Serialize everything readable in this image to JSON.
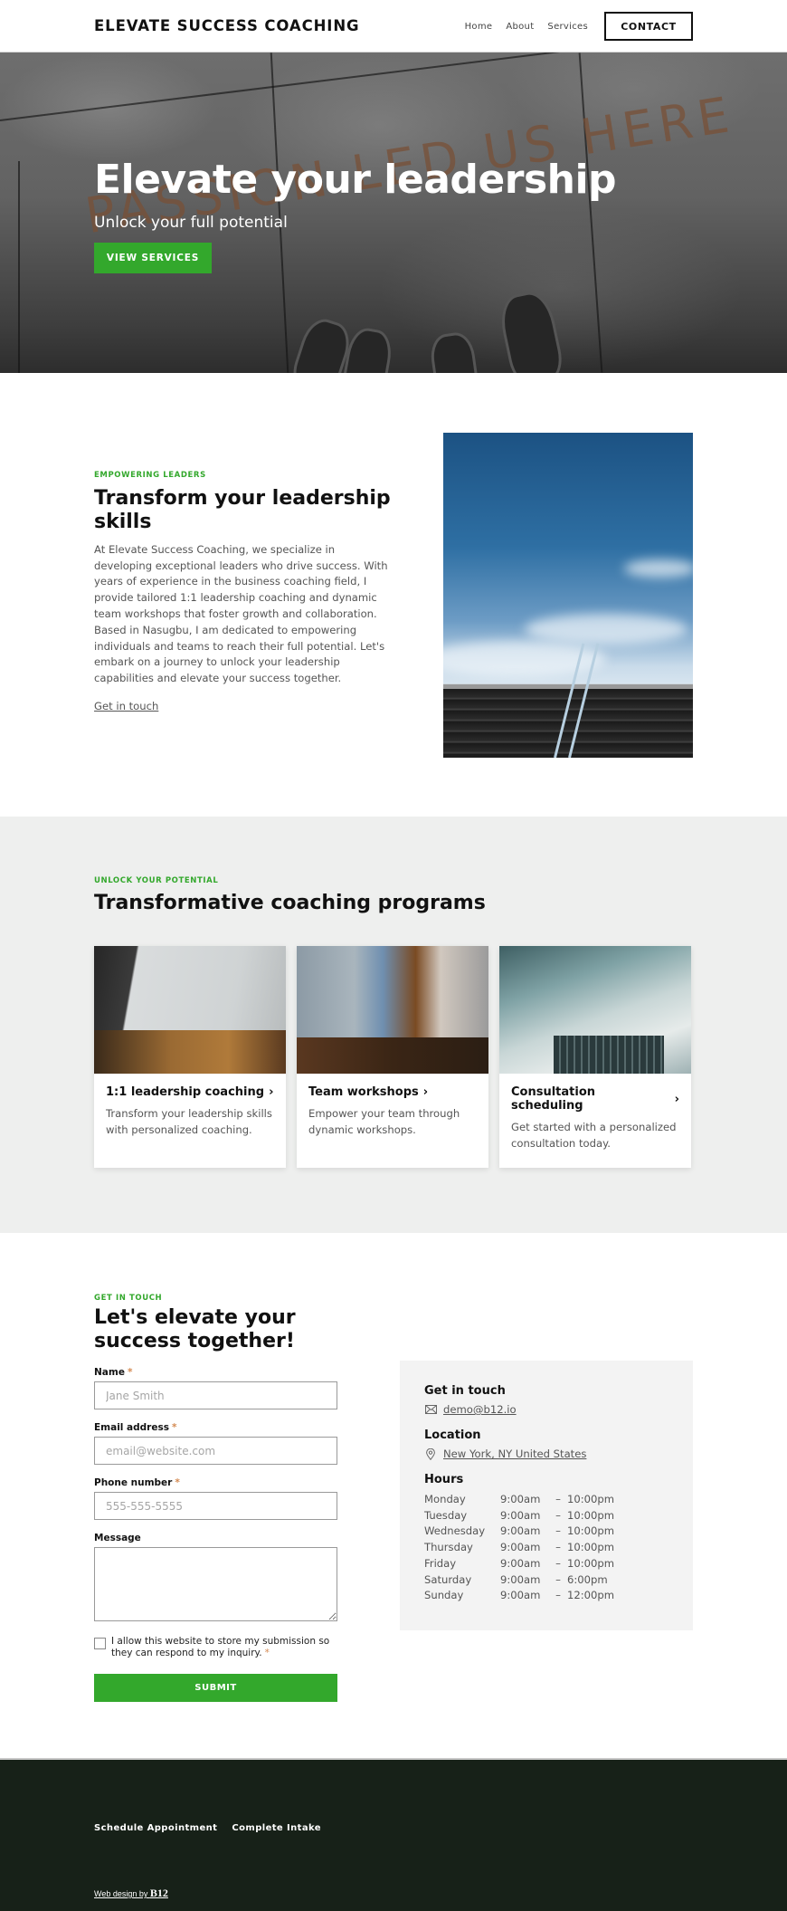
{
  "header": {
    "logo": "ELEVATE SUCCESS COACHING",
    "nav": [
      {
        "label": "Home"
      },
      {
        "label": "About"
      },
      {
        "label": "Services"
      }
    ],
    "contact_label": "CONTACT"
  },
  "hero": {
    "title": "Elevate your leadership",
    "subtitle": "Unlock your full potential",
    "button_label": "VIEW SERVICES",
    "background_text": "PASSION LED US HERE"
  },
  "about": {
    "eyebrow": "EMPOWERING LEADERS",
    "title": "Transform your leadership skills",
    "body": "At Elevate Success Coaching, we specialize in developing exceptional leaders who drive success. With years of experience in the business coaching field, I provide tailored 1:1 leadership coaching and dynamic team workshops that foster growth and collaboration. Based in Nasugbu, I am dedicated to empowering individuals and teams to reach their full potential. Let's embark on a journey to unlock your leadership capabilities and elevate your success together.",
    "link_label": "Get in touch"
  },
  "services": {
    "eyebrow": "UNLOCK YOUR POTENTIAL",
    "title": "Transformative coaching programs",
    "cards": [
      {
        "title": "1:1 leadership coaching",
        "description": "Transform your leadership skills with personalized coaching."
      },
      {
        "title": "Team workshops",
        "description": "Empower your team through dynamic workshops."
      },
      {
        "title": "Consultation scheduling",
        "description": "Get started with a personalized consultation today."
      }
    ]
  },
  "contact": {
    "eyebrow": "GET IN TOUCH",
    "title": "Let's elevate your success together!",
    "form": {
      "name_label": "Name",
      "name_placeholder": "Jane Smith",
      "email_label": "Email address",
      "email_placeholder": "email@website.com",
      "phone_label": "Phone number",
      "phone_placeholder": "555-555-5555",
      "message_label": "Message",
      "consent_text": "I allow this website to store my submission so they can respond to my inquiry.",
      "required_mark": "*",
      "submit_label": "SUBMIT"
    },
    "info": {
      "touch_heading": "Get in touch",
      "email": "demo@b12.io",
      "location_heading": "Location",
      "location": "New York, NY United States",
      "hours_heading": "Hours",
      "hours": [
        {
          "day": "Monday",
          "open": "9:00am",
          "close": "10:00pm"
        },
        {
          "day": "Tuesday",
          "open": "9:00am",
          "close": "10:00pm"
        },
        {
          "day": "Wednesday",
          "open": "9:00am",
          "close": "10:00pm"
        },
        {
          "day": "Thursday",
          "open": "9:00am",
          "close": "10:00pm"
        },
        {
          "day": "Friday",
          "open": "9:00am",
          "close": "10:00pm"
        },
        {
          "day": "Saturday",
          "open": "9:00am",
          "close": "6:00pm"
        },
        {
          "day": "Sunday",
          "open": "9:00am",
          "close": "12:00pm"
        }
      ],
      "dash": "–"
    }
  },
  "footer": {
    "links": [
      {
        "label": "Schedule Appointment"
      },
      {
        "label": "Complete Intake"
      }
    ],
    "credit_prefix": "Web design by ",
    "credit_brand": "B12"
  },
  "colors": {
    "accent_green": "#33a82c",
    "footer_bg": "#172118",
    "services_bg": "#eeefee",
    "info_box_bg": "#f3f3f3",
    "required_star": "#d48a52"
  }
}
